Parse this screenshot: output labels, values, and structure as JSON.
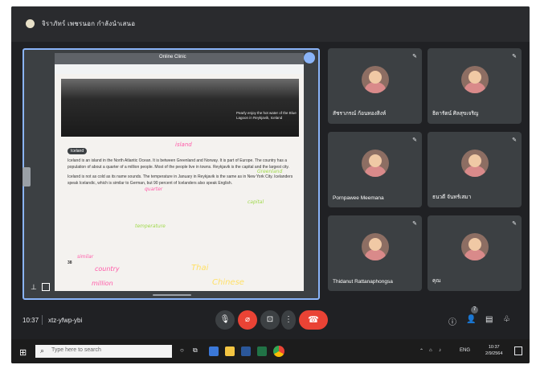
{
  "meeting": {
    "title": "จิราภัทร์ เพชรนอก กำลังนำเสนอ"
  },
  "presentation": {
    "app_title": "Online Clinic",
    "caption": "Pearly enjoy the hot water of the Blue Lagoon in Reykjavik, Iceland",
    "section_label": "Iceland",
    "paragraph_1": "Iceland is an island in the North Atlantic Ocean. It is between Greenland and Norway. It is part of Europe. The country has a population of about a quarter of a million people. Most of the people live in towns. Reykjavik is the capital and the largest city.",
    "paragraph_2": "Iceland is not as cold as its name sounds. The temperature in January in Reykjavik is the same as in New York City. Icelanders speak Icelandic, which is similar to German, but 90 percent of Icelanders also speak English.",
    "page_number": "38",
    "annotations": {
      "a1": "Greenland",
      "a2": "island",
      "a3": "quarter",
      "a4": "capital",
      "a5": "temperature",
      "a6": "similar",
      "a7": "country",
      "a8": "million",
      "a9": "Thai",
      "a10": "Chinese"
    }
  },
  "participants": [
    {
      "name": "สัชราภรณ์ ก้อนทองสิงห์"
    },
    {
      "name": "ธิดารัตน์ ศิลสุขเจริญ"
    },
    {
      "name": "Pornpawee Meemana"
    },
    {
      "name": "ธนวดี จันทร์เสมา"
    },
    {
      "name": "Thidanut Rattanaphongsa"
    },
    {
      "name": "คุณ"
    }
  ],
  "controls": {
    "time": "10:37",
    "meeting_code": "xtz-yfwp-ybi",
    "people_count": "7",
    "mic_icon": "mic-icon",
    "cam_off_icon": "camera-off-icon",
    "present_icon": "present-icon",
    "more_icon": "more-icon",
    "hangup_icon": "hangup-icon"
  },
  "taskbar": {
    "search_placeholder": "Type here to search",
    "language": "ENG",
    "time": "10:37",
    "date": "2/9/2564"
  }
}
